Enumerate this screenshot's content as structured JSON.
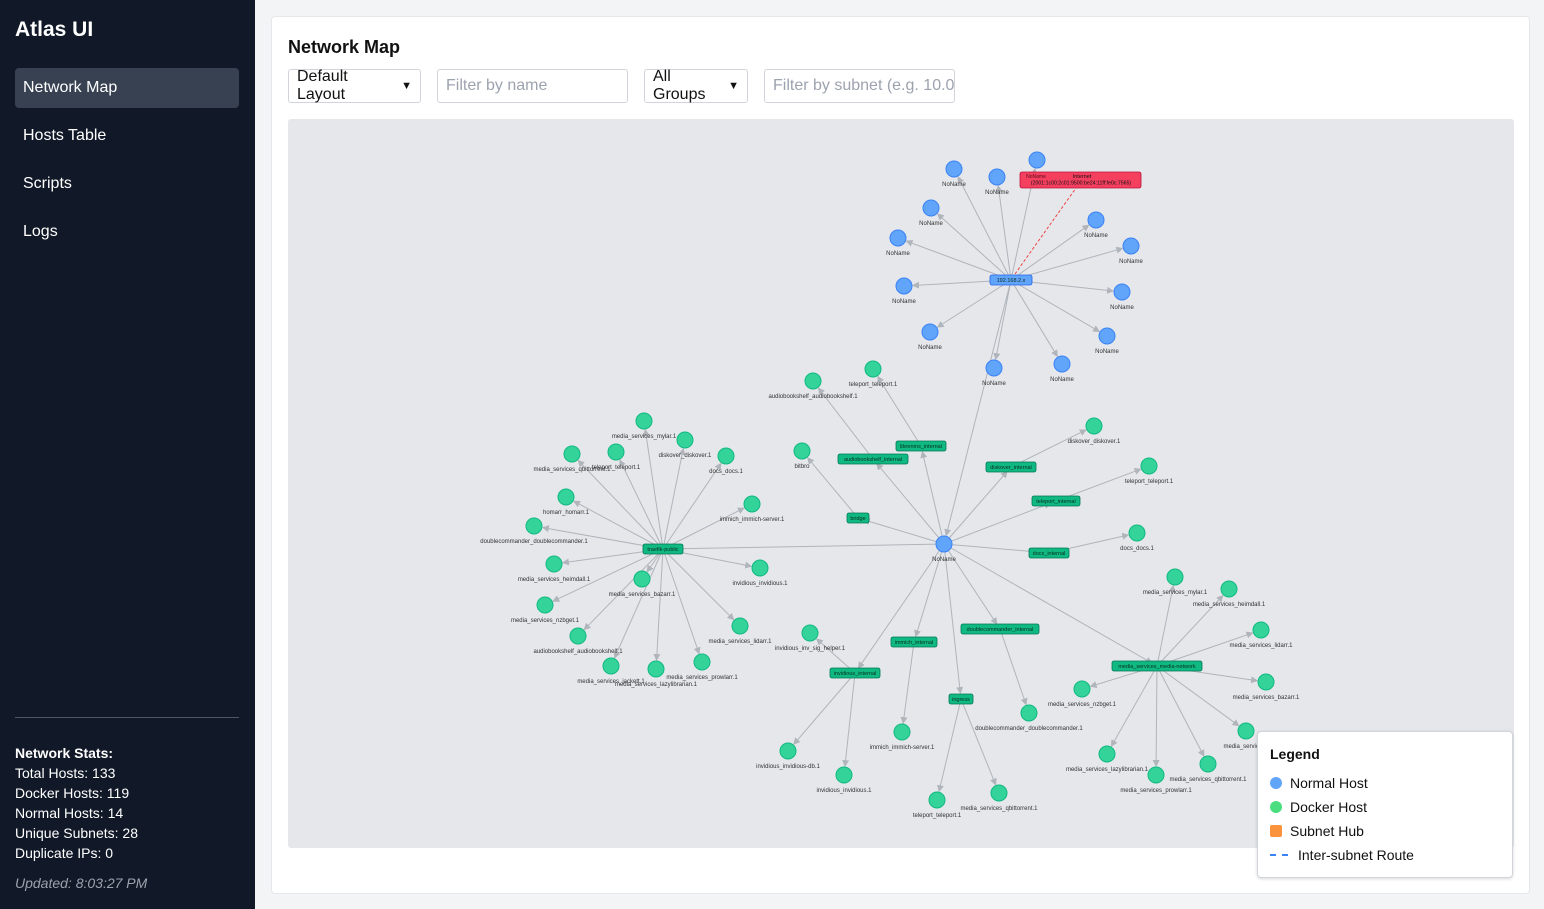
{
  "app_title": "Atlas UI",
  "nav": [
    {
      "label": "Network Map",
      "active": true
    },
    {
      "label": "Hosts Table",
      "active": false
    },
    {
      "label": "Scripts",
      "active": false
    },
    {
      "label": "Logs",
      "active": false
    }
  ],
  "stats": {
    "title": "Network Stats:",
    "total_hosts": "Total Hosts: 133",
    "docker_hosts": "Docker Hosts: 119",
    "normal_hosts": "Normal Hosts: 14",
    "unique_subnets": "Unique Subnets: 28",
    "duplicate_ips": "Duplicate IPs: 0",
    "updated": "Updated: 8:03:27 PM"
  },
  "main": {
    "title": "Network Map",
    "layout_select": "Default Layout",
    "name_filter_placeholder": "Filter by name",
    "group_select": "All Groups",
    "subnet_filter_placeholder": "Filter by subnet (e.g. 10.0."
  },
  "colors": {
    "normal_host": "#60a5fa",
    "docker_host": "#34d399",
    "subnet_hub_green": "#10b981",
    "subnet_hub_orange": "#fb923c",
    "internet": "#f43f5e",
    "edge": "#b0b4bb"
  },
  "legend": {
    "title": "Legend",
    "items": [
      {
        "label": "Normal Host",
        "kind": "dot",
        "color": "#60a5fa"
      },
      {
        "label": "Docker Host",
        "kind": "dot",
        "color": "#4ade80"
      },
      {
        "label": "Subnet Hub",
        "kind": "square",
        "color": "#fb923c"
      },
      {
        "label": "Inter-subnet Route",
        "kind": "dash",
        "color": "#3b82f6"
      }
    ]
  },
  "graph": {
    "hubs": [
      {
        "id": "h192",
        "label": "192.168.2.x",
        "type": "normal"
      },
      {
        "id": "hTraefik",
        "label": "traefik-public",
        "type": "docker"
      },
      {
        "id": "hLibrenms",
        "label": "librenms_internal",
        "type": "docker"
      },
      {
        "id": "hAudio",
        "label": "audiobookshelf_internal",
        "type": "docker"
      },
      {
        "id": "hDiskover",
        "label": "diskover_internal",
        "type": "docker"
      },
      {
        "id": "hTeleport",
        "label": "teleport_internal",
        "type": "docker"
      },
      {
        "id": "hBridge",
        "label": "bridge",
        "type": "docker"
      },
      {
        "id": "hDocs",
        "label": "docs_internal",
        "type": "docker"
      },
      {
        "id": "hImmich",
        "label": "immich_internal",
        "type": "docker"
      },
      {
        "id": "hDouble",
        "label": "doublecommander_internal",
        "type": "docker"
      },
      {
        "id": "hMedia",
        "label": "media_services_media-network",
        "type": "docker"
      },
      {
        "id": "hInv",
        "label": "invidious_internal",
        "type": "docker"
      },
      {
        "id": "hIngress",
        "label": "ingress",
        "type": "docker"
      }
    ],
    "internet": {
      "label": "Internet",
      "sublabel": "NoName",
      "address": "(2001:1c00:2c01:9500:be24:11ff:fe0c:7565)"
    },
    "nodes": [
      {
        "id": "n1",
        "label": "NoName",
        "type": "normal"
      },
      {
        "id": "n2",
        "label": "NoName",
        "type": "normal"
      },
      {
        "id": "n3",
        "label": "",
        "type": "normal"
      },
      {
        "id": "n4",
        "label": "NoName",
        "type": "normal"
      },
      {
        "id": "n5",
        "label": "NoName",
        "type": "normal"
      },
      {
        "id": "n6",
        "label": "NoName",
        "type": "normal"
      },
      {
        "id": "n7",
        "label": "NoName",
        "type": "normal"
      },
      {
        "id": "n8",
        "label": "NoName",
        "type": "normal"
      },
      {
        "id": "n9",
        "label": "NoName",
        "type": "normal"
      },
      {
        "id": "n10",
        "label": "NoName",
        "type": "normal"
      },
      {
        "id": "n11",
        "label": "NoName",
        "type": "normal"
      },
      {
        "id": "n12",
        "label": "NoName",
        "type": "normal"
      },
      {
        "id": "n13",
        "label": "NoName",
        "type": "normal"
      },
      {
        "id": "nCenter",
        "label": "NoName",
        "type": "normal"
      },
      {
        "id": "d1",
        "label": "media_services_mylar.1",
        "type": "docker"
      },
      {
        "id": "d2",
        "label": "diskover_diskover.1",
        "type": "docker"
      },
      {
        "id": "d3",
        "label": "teleport_teleport.1",
        "type": "docker"
      },
      {
        "id": "d4",
        "label": "media_services_qbittorrent.1",
        "type": "docker"
      },
      {
        "id": "d5",
        "label": "docs_docs.1",
        "type": "docker"
      },
      {
        "id": "d6",
        "label": "homarr_homarr.1",
        "type": "docker"
      },
      {
        "id": "d7",
        "label": "immich_immich-server.1",
        "type": "docker"
      },
      {
        "id": "d8",
        "label": "doublecommander_doublecommander.1",
        "type": "docker"
      },
      {
        "id": "d9",
        "label": "media_services_heimdall.1",
        "type": "docker"
      },
      {
        "id": "d10",
        "label": "media_services_bazarr.1",
        "type": "docker"
      },
      {
        "id": "d11",
        "label": "invidious_invidious.1",
        "type": "docker"
      },
      {
        "id": "d12",
        "label": "media_services_nzbget.1",
        "type": "docker"
      },
      {
        "id": "d13",
        "label": "audiobookshelf_audiobookshelf.1",
        "type": "docker"
      },
      {
        "id": "d14",
        "label": "media_services_lidarr.1",
        "type": "docker"
      },
      {
        "id": "d15",
        "label": "media_services_jackett.1",
        "type": "docker"
      },
      {
        "id": "d16",
        "label": "media_services_lazylibrarian.1",
        "type": "docker"
      },
      {
        "id": "d17",
        "label": "media_services_prowlarr.1",
        "type": "docker"
      },
      {
        "id": "d18",
        "label": "audiobookshelf_audiobookshelf.1",
        "type": "docker"
      },
      {
        "id": "d19",
        "label": "teleport_teleport.1",
        "type": "docker"
      },
      {
        "id": "d20",
        "label": "bitbro",
        "type": "docker"
      },
      {
        "id": "d21",
        "label": "diskover_diskover.1",
        "type": "docker"
      },
      {
        "id": "d22",
        "label": "teleport_teleport.1",
        "type": "docker"
      },
      {
        "id": "d23",
        "label": "docs_docs.1",
        "type": "docker"
      },
      {
        "id": "d24",
        "label": "invidious_inv_sig_helper.1",
        "type": "docker"
      },
      {
        "id": "d25",
        "label": "invidious_invidious-db.1",
        "type": "docker"
      },
      {
        "id": "d26",
        "label": "invidious_invidious.1",
        "type": "docker"
      },
      {
        "id": "d27",
        "label": "immich_immich-server.1",
        "type": "docker"
      },
      {
        "id": "d28",
        "label": "teleport_teleport.1",
        "type": "docker"
      },
      {
        "id": "d29",
        "label": "media_services_qbittorrent.1",
        "type": "docker"
      },
      {
        "id": "d30",
        "label": "doublecommander_doublecommander.1",
        "type": "docker"
      },
      {
        "id": "d31",
        "label": "media_services_mylar.1",
        "type": "docker"
      },
      {
        "id": "d32",
        "label": "media_services_heimdall.1",
        "type": "docker"
      },
      {
        "id": "d33",
        "label": "media_services_lidarr.1",
        "type": "docker"
      },
      {
        "id": "d34",
        "label": "media_services_bazarr.1",
        "type": "docker"
      },
      {
        "id": "d35",
        "label": "media_services_nzbget.1",
        "type": "docker"
      },
      {
        "id": "d36",
        "label": "media_services_",
        "type": "docker"
      },
      {
        "id": "d37",
        "label": "media_services_lazylibrarian.1",
        "type": "docker"
      },
      {
        "id": "d38",
        "label": "media_services_prowlarr.1",
        "type": "docker"
      },
      {
        "id": "d39",
        "label": "media_services_qbittorrent.1",
        "type": "docker"
      }
    ]
  }
}
